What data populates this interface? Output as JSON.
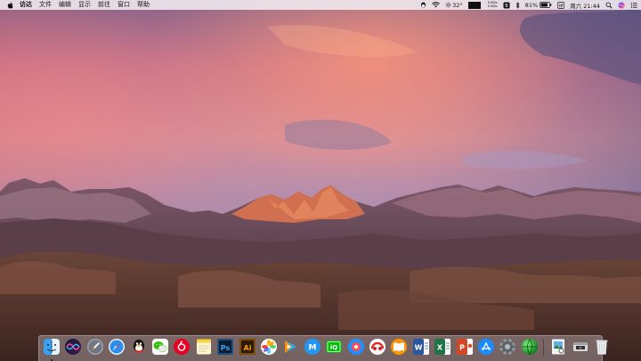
{
  "menubar": {
    "apple": "apple-logo-icon",
    "app_name": "访达",
    "items": [
      "文件",
      "编辑",
      "显示",
      "前往",
      "窗口",
      "帮助"
    ],
    "status": {
      "weather": "32°",
      "net_up": "0 KB/s",
      "net_down": "0 KB/s",
      "cpu_top": "",
      "cpu_bottom": "",
      "battery_percent": "81%",
      "clock": "周六 21:44"
    }
  },
  "dock": {
    "apps": [
      {
        "name": "finder",
        "icon": "finder-icon",
        "running": true
      },
      {
        "name": "siri",
        "icon": "siri-icon",
        "running": false
      },
      {
        "name": "launchpad",
        "icon": "launchpad-rocket-icon",
        "running": false
      },
      {
        "name": "safari",
        "icon": "safari-compass-icon",
        "running": false
      },
      {
        "name": "qq",
        "icon": "qq-penguin-icon",
        "running": false
      },
      {
        "name": "wechat",
        "icon": "wechat-icon",
        "running": false
      },
      {
        "name": "netease-music",
        "icon": "netease-music-icon",
        "running": false
      },
      {
        "name": "notes",
        "icon": "notes-icon",
        "running": false
      },
      {
        "name": "photoshop",
        "icon": "photoshop-icon",
        "label": "Ps",
        "running": false
      },
      {
        "name": "illustrator",
        "icon": "illustrator-icon",
        "label": "Ai",
        "running": false
      },
      {
        "name": "photos",
        "icon": "photos-icon",
        "running": false
      },
      {
        "name": "tencent-video",
        "icon": "tencent-video-icon",
        "running": false
      },
      {
        "name": "maimai",
        "icon": "maimai-icon",
        "running": false
      },
      {
        "name": "iqiyi",
        "icon": "iqiyi-icon",
        "label": "iQ",
        "running": false
      },
      {
        "name": "screen-record",
        "icon": "screen-record-icon",
        "running": false
      },
      {
        "name": "baidu-netdisk",
        "icon": "baidu-netdisk-icon",
        "running": false
      },
      {
        "name": "ibooks",
        "icon": "books-icon",
        "running": false
      },
      {
        "name": "word",
        "icon": "word-icon",
        "label": "W",
        "running": false
      },
      {
        "name": "excel",
        "icon": "excel-icon",
        "label": "X",
        "running": false
      },
      {
        "name": "powerpoint",
        "icon": "powerpoint-icon",
        "label": "P",
        "running": false
      },
      {
        "name": "app-store",
        "icon": "app-store-icon",
        "running": false
      },
      {
        "name": "system-preferences",
        "icon": "system-preferences-gear-icon",
        "running": false
      },
      {
        "name": "sphere-app",
        "icon": "green-sphere-icon",
        "running": false
      },
      {
        "name": "preview",
        "icon": "preview-icon",
        "running": false
      },
      {
        "name": "image-capture",
        "icon": "image-capture-icon",
        "running": false
      },
      {
        "name": "trash",
        "icon": "trash-icon",
        "running": false
      }
    ]
  }
}
